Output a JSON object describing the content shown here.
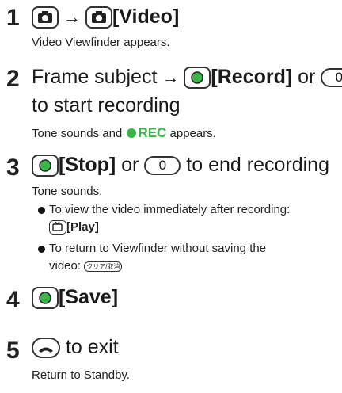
{
  "steps": [
    {
      "num": "1",
      "head": "[Video]",
      "sub": "Video Viewfinder appears."
    },
    {
      "num": "2",
      "head_a": "Frame subject",
      "head_b": "[Record]",
      "head_c": "or",
      "key0": "0",
      "line2": "to start recording",
      "sub_a": "Tone sounds and",
      "sub_rec": "REC",
      "sub_b": "appears."
    },
    {
      "num": "3",
      "head_a": "[Stop]",
      "head_b": "or",
      "key0": "0",
      "head_c": "to end recording",
      "sub": "Tone sounds.",
      "b1": "To view the video immediately after recording:",
      "b1_label": "[Play]",
      "b2": "To return to Viewfinder without saving the",
      "b2_line2": "video:",
      "clear_key": "クリア/取消"
    },
    {
      "num": "4",
      "head": "[Save]"
    },
    {
      "num": "5",
      "head": "to exit",
      "sub": "Return to Standby."
    }
  ],
  "colors": {
    "text": "#1a1a1a",
    "accent_green": "#3bb54a"
  }
}
